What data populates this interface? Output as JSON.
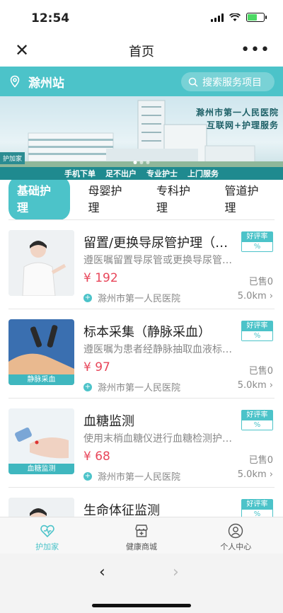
{
  "status": {
    "time": "12:54"
  },
  "nav": {
    "title": "首页"
  },
  "location": {
    "name": "滁州站",
    "search_placeholder": "搜索服务项目"
  },
  "banner": {
    "title_line1": "滁州市第一人民医院",
    "title_line2": "互联网+护理服务",
    "tag": "护加家",
    "slogans": [
      "手机下单",
      "足不出户",
      "专业护士",
      "上门服务"
    ]
  },
  "tabs": [
    "基础护理",
    "母婴护理",
    "专科护理",
    "管道护理"
  ],
  "active_tab": 0,
  "items": [
    {
      "title": "留置/更换导尿管护理（…",
      "desc": "遵医嘱留置导尿管或更换导尿管…",
      "price": "¥ 192",
      "sold": "已售0",
      "hospital": "滁州市第一人民医院",
      "distance": "5.0km",
      "rating_label": "好评率",
      "rating_value": "%",
      "thumb_label": ""
    },
    {
      "title": "标本采集（静脉采血）",
      "desc": "遵医嘱为患者经静脉抽取血液标…",
      "price": "¥ 97",
      "sold": "已售0",
      "hospital": "滁州市第一人民医院",
      "distance": "5.0km",
      "rating_label": "好评率",
      "rating_value": "%",
      "thumb_label": "静脉采血"
    },
    {
      "title": "血糖监测",
      "desc": "使用末梢血糖仪进行血糖检测护…",
      "price": "¥ 68",
      "sold": "已售0",
      "hospital": "滁州市第一人民医院",
      "distance": "5.0km",
      "rating_label": "好评率",
      "rating_value": "%",
      "thumb_label": "血糖监测"
    },
    {
      "title": "生命体征监测",
      "desc": "",
      "price": "",
      "sold": "",
      "hospital": "",
      "distance": "",
      "rating_label": "好评率",
      "rating_value": "%",
      "thumb_label": ""
    }
  ],
  "tabbar": [
    {
      "label": "护加家",
      "icon": "heart-icon"
    },
    {
      "label": "健康商城",
      "icon": "store-icon"
    },
    {
      "label": "个人中心",
      "icon": "user-icon"
    }
  ],
  "colors": {
    "accent": "#4cc3c9",
    "price": "#e8465a"
  }
}
